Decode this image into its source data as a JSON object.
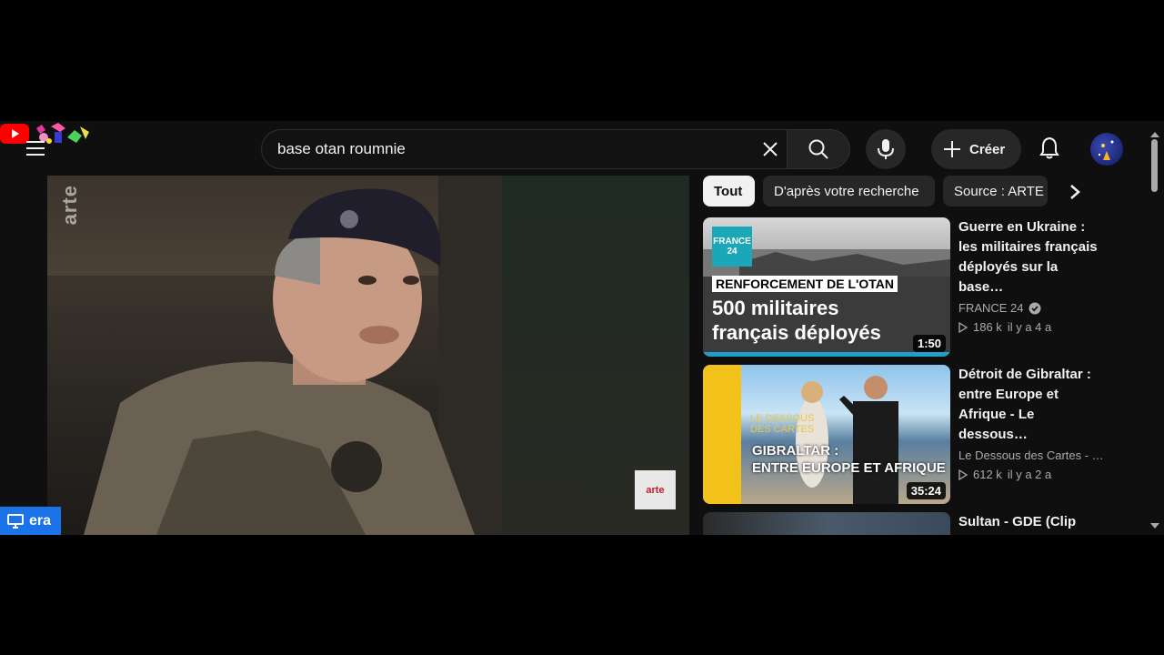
{
  "search": {
    "query": "base otan roumnie"
  },
  "header": {
    "create_label": "Créer"
  },
  "player": {
    "watermark": "arte",
    "corner_badge": "arte"
  },
  "overlay": {
    "era_label": "era"
  },
  "chips": [
    {
      "label": "Tout"
    },
    {
      "label": "D'après votre recherche"
    },
    {
      "label": "Source : ARTE"
    }
  ],
  "videos": [
    {
      "title": "Guerre en Ukraine : les militaires français déployés sur la base…",
      "channel": "FRANCE 24",
      "views": "186 k",
      "age": "il y a 4 a",
      "duration": "1:50",
      "thumb_tag": "RENFORCEMENT DE L'OTAN",
      "thumb_line1": "500 militaires",
      "thumb_line2": "français déployés",
      "thumb_logo": "FRANCE 24"
    },
    {
      "title": "Détroit de Gibraltar : entre Europe et Afrique - Le dessous…",
      "channel": "Le Dessous des Cartes - …",
      "views": "612 k",
      "age": "il y a 2 a",
      "duration": "35:24",
      "thumb_small1": "LE DESSOUS",
      "thumb_small2": "DES CARTES",
      "thumb_line1": "GIBRALTAR :",
      "thumb_line2": "ENTRE EUROPE ET AFRIQUE"
    },
    {
      "title": "Sultan - GDE (Clip"
    }
  ],
  "colors": {
    "background": "#0f0f0f",
    "era_blue": "#1a73e8",
    "youtube_red": "#ff0000"
  }
}
